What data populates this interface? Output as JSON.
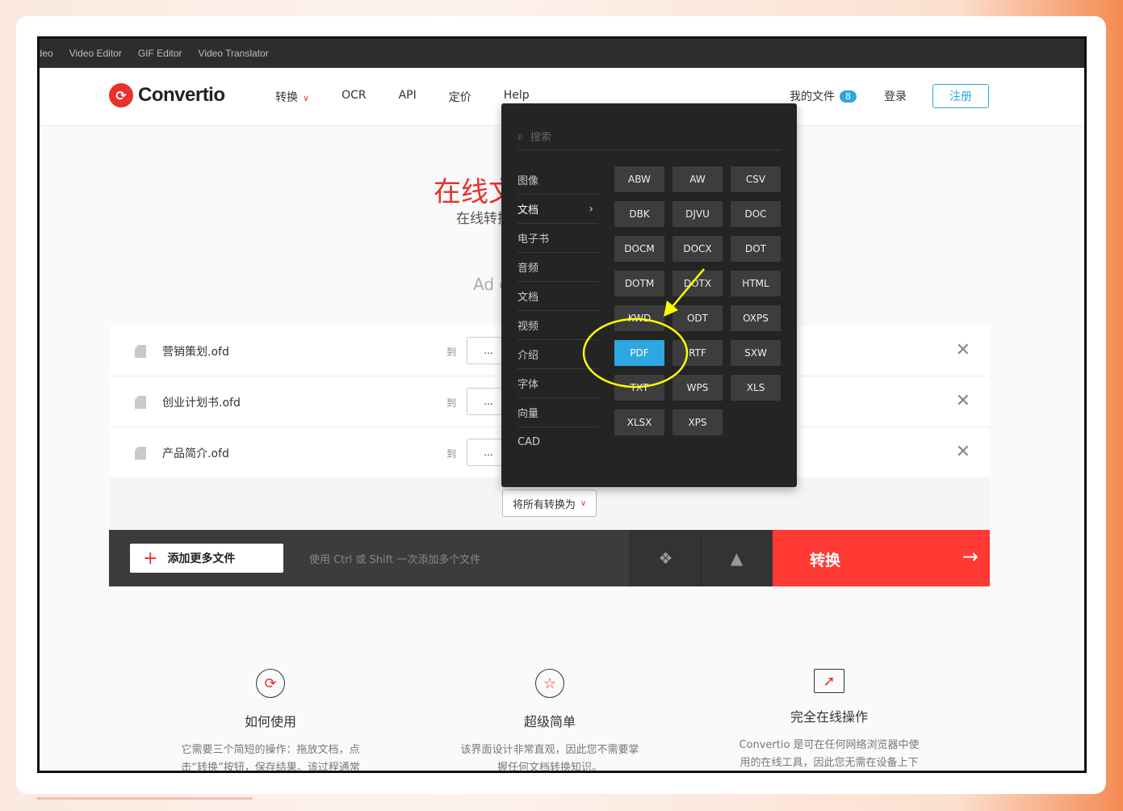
{
  "topbar": {
    "items": [
      "ideo",
      "Video Editor",
      "GIF Editor",
      "Video Translator"
    ]
  },
  "header": {
    "logo_text": "Convertio",
    "nav": [
      "转换",
      "OCR",
      "API",
      "定价",
      "Help"
    ],
    "my_files": "我的文件",
    "file_count": "8",
    "login": "登录",
    "signup": "注册"
  },
  "hero": {
    "title": "在线文",
    "subtitle": "在线转换",
    "ad_text": "Ad c"
  },
  "files": [
    {
      "name": "营销策划.ofd",
      "to": "到",
      "format": "..."
    },
    {
      "name": "创业计划书.ofd",
      "to": "到",
      "format": "..."
    },
    {
      "name": "产品简介.ofd",
      "to": "到",
      "format": "..."
    }
  ],
  "convert_all": "将所有转换为",
  "action_bar": {
    "add_more": "添加更多文件",
    "hint": "使用 Ctrl 或 Shift 一次添加多个文件",
    "convert": "转换"
  },
  "features": [
    {
      "icon": "refresh-icon",
      "title": "如何使用",
      "desc_line1": "它需要三个简短的操作：拖放文档，点",
      "desc_line2": "击“转换”按钮，保存结果。该过程通常"
    },
    {
      "icon": "star-icon",
      "title": "超级简单",
      "desc_line1": "该界面设计非常直观，因此您不需要掌",
      "desc_line2": "握任何文档转换知识。"
    },
    {
      "icon": "browser-cursor-icon",
      "title": "完全在线操作",
      "desc_line1": "Convertio 是可在任何网络浏览器中使",
      "desc_line2": "用的在线工具，因此您无需在设备上下"
    }
  ],
  "dropdown": {
    "search_placeholder": "搜索",
    "categories": [
      "图像",
      "文档",
      "电子书",
      "音频",
      "文档",
      "视频",
      "介绍",
      "字体",
      "向量",
      "CAD"
    ],
    "active_category": "文档",
    "formats": [
      "ABW",
      "AW",
      "CSV",
      "DBK",
      "DJVU",
      "DOC",
      "DOCM",
      "DOCX",
      "DOT",
      "DOTM",
      "DOTX",
      "HTML",
      "KWD",
      "ODT",
      "OXPS",
      "PDF",
      "RTF",
      "SXW",
      "TXT",
      "WPS",
      "XLS",
      "XLSX",
      "XPS"
    ],
    "selected_format": "PDF"
  },
  "colors": {
    "accent": "#e8312d",
    "selected": "#2ea7e0",
    "annotation": "#ffff00"
  }
}
